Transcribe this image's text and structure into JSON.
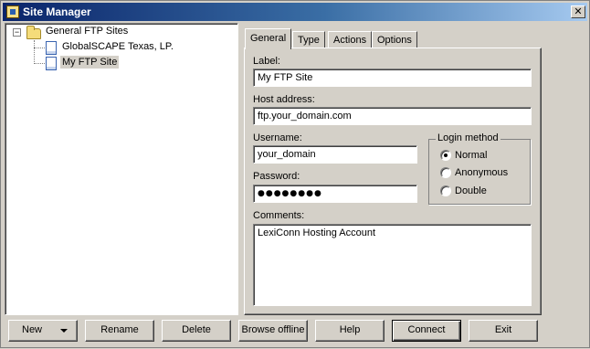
{
  "window": {
    "title": "Site Manager",
    "close_icon": "close-icon"
  },
  "tree": {
    "root": {
      "label": "General FTP Sites",
      "expander": "⊟",
      "icon": "folder-icon"
    },
    "children": [
      {
        "label": "GlobalSCAPE Texas, LP.",
        "icon": "page-icon",
        "selected": false
      },
      {
        "label": "My FTP Site",
        "icon": "page-icon",
        "selected": true
      }
    ]
  },
  "tabs": [
    {
      "label": "General",
      "active": true
    },
    {
      "label": "Type",
      "active": false
    },
    {
      "label": "Actions",
      "active": false
    },
    {
      "label": "Options",
      "active": false
    }
  ],
  "general": {
    "label_caption": "Label:",
    "label_value": "My FTP Site",
    "host_caption": "Host address:",
    "host_value": "ftp.your_domain.com",
    "username_caption": "Username:",
    "username_value": "your_domain",
    "password_caption": "Password:",
    "password_value": "●●●●●●●●",
    "comments_caption": "Comments:",
    "comments_value": "LexiConn Hosting Account"
  },
  "login_method": {
    "title": "Login method",
    "options": [
      {
        "label": "Normal",
        "checked": true
      },
      {
        "label": "Anonymous",
        "checked": false
      },
      {
        "label": "Double",
        "checked": false
      }
    ]
  },
  "buttons": {
    "new": "New",
    "rename": "Rename",
    "delete": "Delete",
    "browse_offline": "Browse offline",
    "help": "Help",
    "connect": "Connect",
    "exit": "Exit"
  }
}
